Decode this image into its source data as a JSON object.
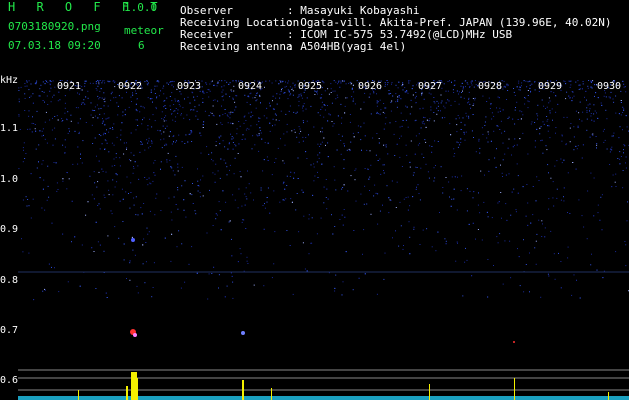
{
  "header": {
    "app_logo": "H R O F F T",
    "version": "1.0.0",
    "filename": "0703180920.png",
    "datetime": "07.03.18 09:20",
    "meteor_label": "meteor",
    "meteor_count": "6",
    "observer_label": "Observer",
    "observer_value": ": Masayuki Kobayashi",
    "location_label": "Receiving Location",
    "location_value": ": Ogata-vill. Akita-Pref. JAPAN (139.96E, 40.02N)",
    "receiver_label": "Receiver",
    "receiver_value": ": ICOM IC-575 53.7492(@LCD)MHz USB",
    "antenna_label": "Receiving antenna",
    "antenna_value": ": A504HB(yagi 4el)"
  },
  "spectrogram": {
    "y_unit": "kHz",
    "y_ticks": [
      "1.1",
      "1.0",
      "0.9",
      "0.8",
      "0.7",
      "0.6"
    ],
    "x_ticks": [
      "0921",
      "0922",
      "0923",
      "0924",
      "0925",
      "0926",
      "0927",
      "0928",
      "0929",
      "0930"
    ],
    "colors": {
      "background": "#000000",
      "noise": "#2a40d0",
      "text_header": "#22e84a",
      "meteor_echo": "#ff3030",
      "level_trace": "#f4f000"
    }
  }
}
